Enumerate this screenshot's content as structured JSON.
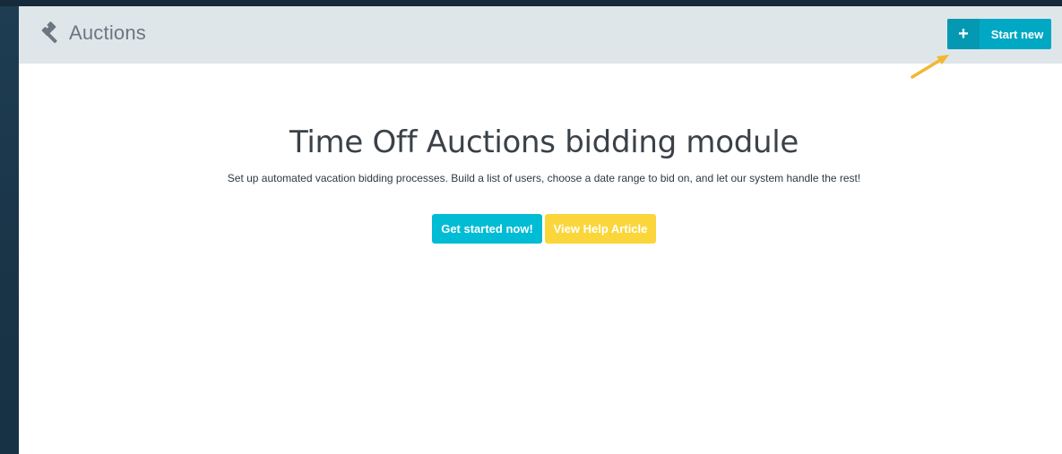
{
  "header": {
    "title": "Auctions",
    "icon": "gavel-icon",
    "start_new": {
      "icon": "plus-icon",
      "plus_glyph": "+",
      "label": "Start new"
    }
  },
  "hero": {
    "title": "Time Off Auctions bidding module",
    "subtitle": "Set up automated vacation bidding processes. Build a list of users, choose a date range to bid on, and let our system handle the rest!",
    "primary_button": "Get started now!",
    "secondary_button": "View Help Article"
  },
  "colors": {
    "header_bg": "#dfe6ea",
    "primary_accent": "#00bcd4",
    "start_new_bg": "#00a8c4",
    "help_button_bg": "#fbd63a",
    "annotation_arrow": "#f2b731",
    "sidebar_bg": "#1c3a4f"
  }
}
